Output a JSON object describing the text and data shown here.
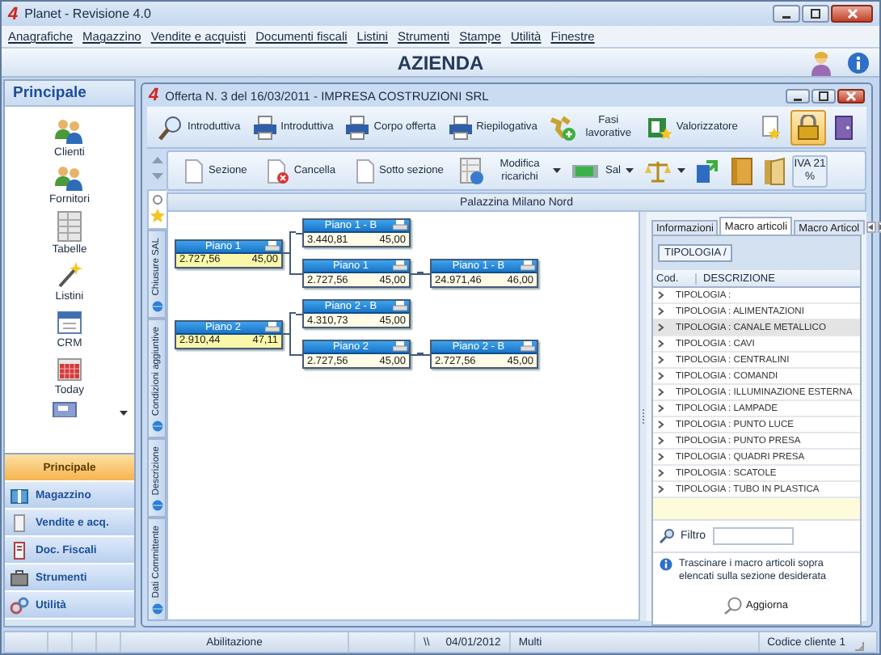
{
  "window": {
    "logo": "4",
    "title": "Planet - Revisione 4.0"
  },
  "menu": [
    "Anagrafiche",
    "Magazzino",
    "Vendite e acquisti",
    "Documenti fiscali",
    "Listini",
    "Strumenti",
    "Stampe",
    "Utilità",
    "Finestre"
  ],
  "company": {
    "title": "AZIENDA"
  },
  "sidebar": {
    "header": "Principale",
    "items": [
      {
        "label": "Clienti"
      },
      {
        "label": "Fornitori"
      },
      {
        "label": "Tabelle"
      },
      {
        "label": "Listini"
      },
      {
        "label": "CRM"
      },
      {
        "label": "Today"
      }
    ],
    "nav": [
      {
        "label": "Principale",
        "selected": true
      },
      {
        "label": "Magazzino",
        "selected": false
      },
      {
        "label": "Vendite e acq.",
        "selected": false
      },
      {
        "label": "Doc. Fiscali",
        "selected": false
      },
      {
        "label": "Strumenti",
        "selected": false
      },
      {
        "label": "Utilità",
        "selected": false
      }
    ]
  },
  "document": {
    "logo": "4",
    "title": "Offerta N. 3 del 16/03/2011 - IMPRESA COSTRUZIONI SRL",
    "toolbar": [
      {
        "label": "Introduttiva",
        "selected": false
      },
      {
        "label": "Introduttiva",
        "selected": false
      },
      {
        "label": "Corpo offerta",
        "selected": false
      },
      {
        "label": "Riepilogativa",
        "selected": false
      },
      {
        "label": "Fasi lavorative",
        "selected": false
      },
      {
        "label": "Valorizzatore",
        "selected": false
      },
      {
        "selected": false
      },
      {
        "selected": true
      },
      {
        "selected": false
      }
    ],
    "subtoolbar": [
      {
        "kind": "button",
        "label": "Sezione"
      },
      {
        "kind": "button",
        "label": "Cancella"
      },
      {
        "kind": "button",
        "label": "Sotto sezione"
      },
      {
        "kind": "button",
        "label": "Modifica ricarichi",
        "dropdown": true
      },
      {
        "kind": "button",
        "label": "Sal",
        "dropdown": true
      },
      {
        "kind": "button",
        "dropdown": true
      },
      {
        "kind": "button"
      },
      {
        "kind": "button"
      },
      {
        "kind": "button"
      },
      {
        "kind": "badge",
        "label": "IVA 21 %"
      }
    ],
    "section_title": "Palazzina Milano Nord",
    "side_tabs": [
      "Chiusure SAL",
      "Condizioni aggiuntive",
      "Descrizione",
      "Dati Committente"
    ],
    "diagram": {
      "nodes": [
        {
          "kind": "root",
          "title": "Piano 1",
          "amount": "2.727,56",
          "percent": "45,00",
          "children": [
            {
              "kind": "child",
              "title": "Piano 1 - B",
              "amount": "3.440,81",
              "percent": "45,00"
            },
            {
              "kind": "child",
              "title": "Piano 1",
              "amount": "2.727,56",
              "percent": "45,00",
              "children": [
                {
                  "kind": "child",
                  "title": "Piano 1 - B",
                  "amount": "24.971,46",
                  "percent": "46,00"
                }
              ]
            }
          ]
        },
        {
          "kind": "root",
          "title": "Piano 2",
          "amount": "2.910,44",
          "percent": "47,11",
          "children": [
            {
              "kind": "child",
              "title": "Piano 2 - B",
              "amount": "4.310,73",
              "percent": "45,00"
            },
            {
              "kind": "child",
              "title": "Piano 2",
              "amount": "2.727,56",
              "percent": "45,00",
              "children": [
                {
                  "kind": "child",
                  "title": "Piano 2 - B",
                  "amount": "2.727,56",
                  "percent": "45,00"
                }
              ]
            }
          ]
        }
      ]
    },
    "macro_panel": {
      "tabs": [
        {
          "label": "Informazioni",
          "selected": false
        },
        {
          "label": "Macro articoli",
          "selected": true
        },
        {
          "label": "Macro Articol",
          "selected": false
        }
      ],
      "group_chip": "TIPOLOGIA /",
      "columns": [
        "Cod.",
        "DESCRIZIONE"
      ],
      "rows": [
        {
          "description": "TIPOLOGIA :",
          "selected": false
        },
        {
          "description": "TIPOLOGIA : ALIMENTAZIONI",
          "selected": false
        },
        {
          "description": "TIPOLOGIA : CANALE METALLICO",
          "selected": true
        },
        {
          "description": "TIPOLOGIA : CAVI",
          "selected": false
        },
        {
          "description": "TIPOLOGIA : CENTRALINI",
          "selected": false
        },
        {
          "description": "TIPOLOGIA : COMANDI",
          "selected": false
        },
        {
          "description": "TIPOLOGIA : ILLUMINAZIONE ESTERNA",
          "selected": false
        },
        {
          "description": "TIPOLOGIA : LAMPADE",
          "selected": false
        },
        {
          "description": "TIPOLOGIA : PUNTO LUCE",
          "selected": false
        },
        {
          "description": "TIPOLOGIA : PUNTO PRESA",
          "selected": false
        },
        {
          "description": "TIPOLOGIA : QUADRI PRESA",
          "selected": false
        },
        {
          "description": "TIPOLOGIA : SCATOLE",
          "selected": false
        },
        {
          "description": "TIPOLOGIA : TUBO IN PLASTICA",
          "selected": false
        }
      ],
      "filter": {
        "label": "Filtro"
      },
      "hint": "Trascinare i macro articoli sopra elencati sulla sezione desiderata",
      "refresh": "Aggiorna"
    }
  },
  "status_bar": [
    "Abilitazione",
    "\\\\",
    "04/01/2012",
    "Multi",
    "Codice cliente 1"
  ]
}
